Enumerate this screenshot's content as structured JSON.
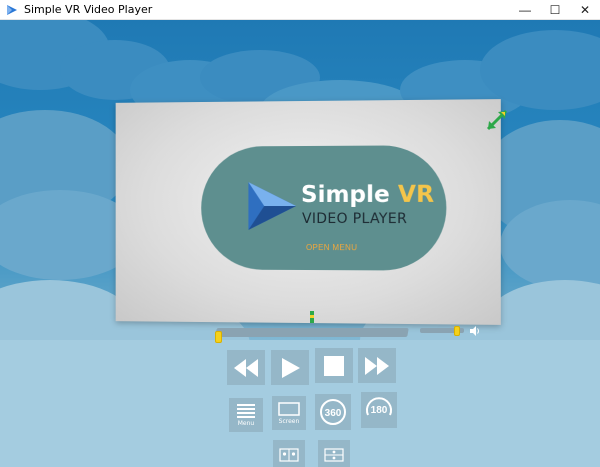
{
  "window": {
    "title": "Simple VR Video Player",
    "minimize_glyph": "—",
    "maximize_glyph": "☐",
    "close_glyph": "✕"
  },
  "logo": {
    "word1": "Simple",
    "word2": "VR",
    "subtitle": "VIDEO PLAYER",
    "open_menu": "OPEN MENU"
  },
  "controls": {
    "seek_progress": 0.0,
    "volume_level": 0.85,
    "buttons": [
      {
        "name": "rewind",
        "icon": "rewind-icon",
        "label": ""
      },
      {
        "name": "play",
        "icon": "play-icon",
        "label": ""
      },
      {
        "name": "stop",
        "icon": "stop-icon",
        "label": ""
      },
      {
        "name": "fast-forward",
        "icon": "fast-forward-icon",
        "label": ""
      },
      {
        "name": "menu",
        "icon": "menu-icon",
        "label": "Menu"
      },
      {
        "name": "screen",
        "icon": "screen-icon",
        "label": "Screen"
      },
      {
        "name": "mode-360",
        "icon": "360-icon",
        "label": "360"
      },
      {
        "name": "mode-180",
        "icon": "180-icon",
        "label": "180"
      }
    ]
  },
  "colors": {
    "sky": "#1f79b4",
    "accent_yellow": "#f4c54a",
    "pill": "#5e8f8f",
    "button_bg": "#95b7c8"
  }
}
